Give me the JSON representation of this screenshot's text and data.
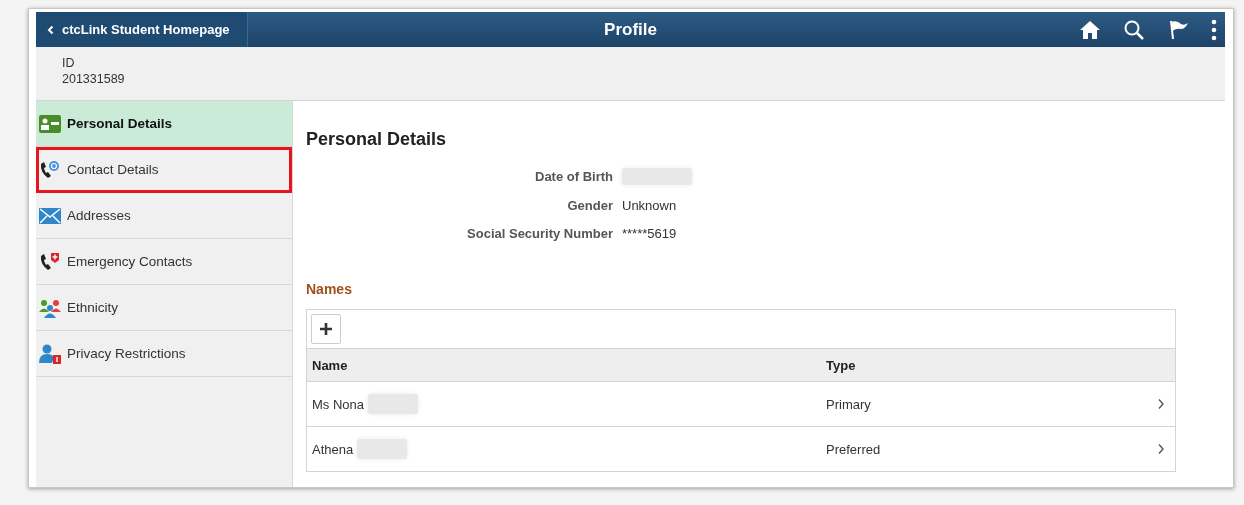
{
  "header": {
    "back_label": "ctcLink Student Homepage",
    "title": "Profile"
  },
  "id_band": {
    "label": "ID",
    "value": "201331589"
  },
  "sidebar": {
    "items": [
      {
        "label": "Personal Details",
        "selected": true,
        "highlighted": false
      },
      {
        "label": "Contact Details",
        "selected": false,
        "highlighted": true
      },
      {
        "label": "Addresses",
        "selected": false,
        "highlighted": false
      },
      {
        "label": "Emergency Contacts",
        "selected": false,
        "highlighted": false
      },
      {
        "label": "Ethnicity",
        "selected": false,
        "highlighted": false
      },
      {
        "label": "Privacy Restrictions",
        "selected": false,
        "highlighted": false
      }
    ]
  },
  "content": {
    "title": "Personal Details",
    "fields": [
      {
        "label": "Date of Birth",
        "redacted": true
      },
      {
        "label": "Gender",
        "value": "Unknown",
        "redacted": false
      },
      {
        "label": "Social Security Number",
        "value": "*****5619",
        "redacted": false
      }
    ],
    "names": {
      "title": "Names",
      "columns": [
        "Name",
        "Type"
      ],
      "rows": [
        {
          "name": "Ms Nona",
          "type": "Primary",
          "redacted": true
        },
        {
          "name": "Athena",
          "type": "Preferred",
          "redacted": true
        }
      ]
    }
  }
}
